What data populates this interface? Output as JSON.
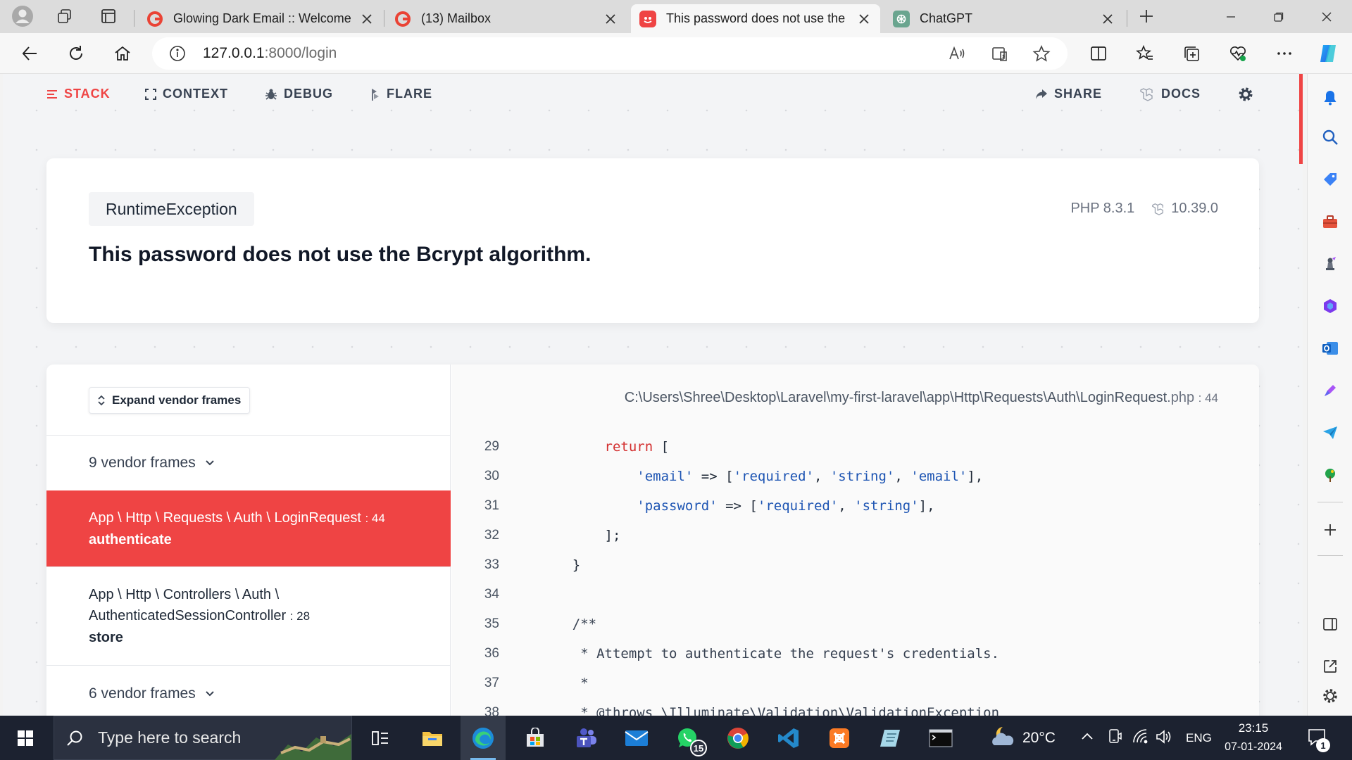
{
  "browser": {
    "tabs": [
      {
        "title": "Glowing Dark Email :: Welcome t",
        "favicon": "google-g-icon",
        "active": false
      },
      {
        "title": "(13) Mailbox",
        "favicon": "google-g-icon",
        "active": false
      },
      {
        "title": "This password does not use the",
        "favicon": "ignition-icon",
        "active": true
      },
      {
        "title": "ChatGPT",
        "favicon": "chatgpt-icon",
        "active": false
      }
    ],
    "url_host": "127.0.0.1",
    "url_rest": ":8000/login"
  },
  "ignition": {
    "nav": {
      "stack": "STACK",
      "context": "CONTEXT",
      "debug": "DEBUG",
      "flare": "FLARE",
      "share": "SHARE",
      "docs": "DOCS"
    },
    "exception": {
      "class": "RuntimeException",
      "php_version": "PHP 8.3.1",
      "laravel_version": "10.39.0",
      "message": "This password does not use the Bcrypt algorithm."
    },
    "stack": {
      "expand_label": "Expand vendor frames",
      "vendor_top": "9 vendor frames",
      "frames": [
        {
          "path": "App \\ Http \\ Requests \\ Auth \\ LoginRequest",
          "line": ": 44",
          "method": "authenticate"
        },
        {
          "path_1": "App \\ Http \\ Controllers \\ Auth \\",
          "path_2": "AuthenticatedSessionController",
          "line": ": 28",
          "method": "store"
        }
      ],
      "vendor_bottom": "6 vendor frames"
    },
    "code": {
      "file": "C:\\Users\\Shree\\Desktop\\Laravel\\my-first-laravel\\app\\Http\\Requests\\Auth\\LoginRequest",
      "ext": ".php",
      "line": ": 44",
      "lines": [
        {
          "n": "29",
          "tokens": [
            [
              "        ",
              ""
            ],
            [
              "return",
              "kw"
            ],
            [
              " [",
              ""
            ]
          ]
        },
        {
          "n": "30",
          "tokens": [
            [
              "            ",
              ""
            ],
            [
              "'email'",
              "str"
            ],
            [
              " => [",
              ""
            ],
            [
              "'required'",
              "str"
            ],
            [
              ", ",
              ""
            ],
            [
              "'string'",
              "str"
            ],
            [
              ", ",
              ""
            ],
            [
              "'email'",
              "str"
            ],
            [
              "],",
              ""
            ]
          ]
        },
        {
          "n": "31",
          "tokens": [
            [
              "            ",
              ""
            ],
            [
              "'password'",
              "str"
            ],
            [
              " => [",
              ""
            ],
            [
              "'required'",
              "str"
            ],
            [
              ", ",
              ""
            ],
            [
              "'string'",
              "str"
            ],
            [
              "],",
              ""
            ]
          ]
        },
        {
          "n": "32",
          "tokens": [
            [
              "        ];",
              ""
            ]
          ]
        },
        {
          "n": "33",
          "tokens": [
            [
              "    }",
              ""
            ]
          ]
        },
        {
          "n": "34",
          "tokens": [
            [
              "",
              ""
            ]
          ]
        },
        {
          "n": "35",
          "tokens": [
            [
              "    /**",
              "cm"
            ]
          ]
        },
        {
          "n": "36",
          "tokens": [
            [
              "     * Attempt to authenticate the request's credentials.",
              "cm"
            ]
          ]
        },
        {
          "n": "37",
          "tokens": [
            [
              "     *",
              "cm"
            ]
          ]
        },
        {
          "n": "38",
          "tokens": [
            [
              "     * @throws \\Illuminate\\Validation\\ValidationException",
              "cm"
            ]
          ]
        }
      ]
    }
  },
  "taskbar": {
    "search_placeholder": "Type here to search",
    "weather": "20°C",
    "language": "ENG",
    "time": "23:15",
    "date": "07-01-2024",
    "whatsapp_badge": "15",
    "notification_badge": "1"
  }
}
